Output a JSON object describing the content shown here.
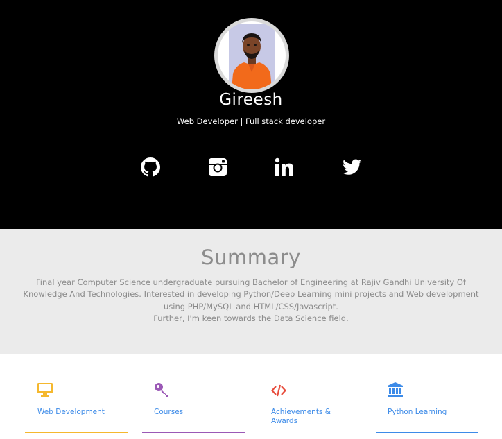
{
  "profile": {
    "name": "Gireesh",
    "role": "Web Developer | Full stack developer",
    "avatar_alt": "Profile photo"
  },
  "social": [
    {
      "name": "github",
      "icon": "github-icon"
    },
    {
      "name": "instagram",
      "icon": "instagram-icon"
    },
    {
      "name": "linkedin",
      "icon": "linkedin-icon"
    },
    {
      "name": "twitter",
      "icon": "twitter-icon"
    }
  ],
  "summary": {
    "title": "Summary",
    "paragraph_1": "Final year Computer Science undergraduate pursuing Bachelor of Engineering at Rajiv Gandhi University Of Knowledge And Technologies. Interested in developing Python/Deep Learning mini projects and Web development using PHP/MySQL and HTML/CSS/Javascript.",
    "paragraph_2": "Further, I'm keen towards the Data Science field."
  },
  "skills": [
    {
      "label": "Web Development",
      "icon": "monitor-icon",
      "color": "#f5b82e"
    },
    {
      "label": "Courses",
      "icon": "key-icon",
      "color": "#9b59b6"
    },
    {
      "label": "Achievements & Awards",
      "icon": "code-icon",
      "color": "#e74c3c"
    },
    {
      "label": "Python Learning",
      "icon": "bank-icon",
      "color": "#3d8be8"
    }
  ],
  "colors": {
    "hero_bg": "#000000",
    "summary_bg": "#ebebeb",
    "link": "#3d8be8"
  }
}
